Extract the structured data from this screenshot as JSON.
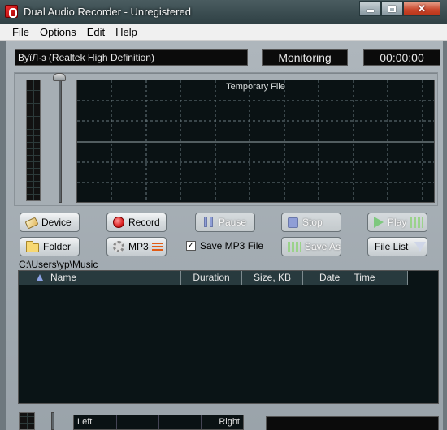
{
  "window": {
    "title": "Dual Audio Recorder - Unregistered",
    "controls": {
      "minimize": "minimize",
      "maximize": "maximize",
      "close": "✕"
    }
  },
  "menu": [
    "File",
    "Options",
    "Edit",
    "Help"
  ],
  "display": {
    "device": "ВуїЛ·з (Realtek High Definition)",
    "status": "Monitoring",
    "timer": "00:00:00",
    "scope_label": "Temporary File"
  },
  "buttons": {
    "device": "Device",
    "record": "Record",
    "pause": "Pause",
    "stop": "Stop",
    "play": "Play",
    "folder": "Folder",
    "mp3": "MP3",
    "save_as": "Save As",
    "file_list": "File List"
  },
  "save_mp3": {
    "label": "Save MP3 File",
    "checked": true,
    "mark": "✓"
  },
  "path": "C:\\Users\\yp\\Music",
  "list": {
    "columns": {
      "name": "Name",
      "duration": "Duration",
      "size": "Size, KB",
      "date": "Date",
      "time": "Time"
    },
    "rows": []
  },
  "balance": {
    "left": "Left",
    "right": "Right"
  },
  "colors": {
    "lcd_bg": "#0b0b0b",
    "scope_grid": "#6b7b80",
    "panel": "#aeb6bc",
    "record_red": "#d22222",
    "disabled_blue": "#8f9ed6",
    "play_green": "#7ec87e",
    "mp3_orange": "#e25b14"
  }
}
